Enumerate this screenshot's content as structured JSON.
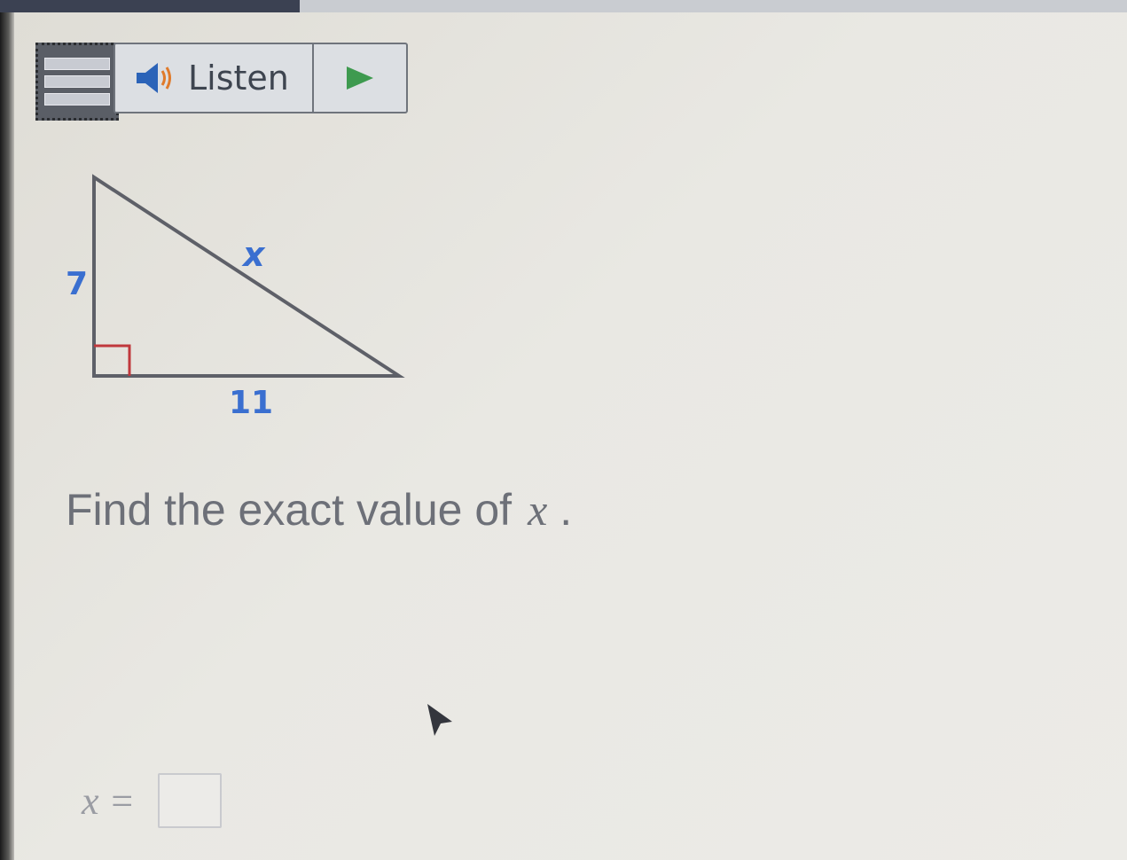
{
  "toolbar": {
    "listen_label": "Listen",
    "menu_icon": "hamburger-menu-icon",
    "speaker_icon": "speaker-icon",
    "play_icon": "play-icon"
  },
  "figure": {
    "side_vertical": "7",
    "side_horizontal": "11",
    "side_hypotenuse": "x",
    "right_angle_marker_color": "#c0383c",
    "label_color": "#3a6fd0"
  },
  "question": {
    "text": "Find the exact value of",
    "variable": "x",
    "period": "."
  },
  "answer": {
    "label": "x ="
  },
  "colors": {
    "play_green": "#3e9a4f",
    "speaker_blue": "#2b63b8"
  }
}
